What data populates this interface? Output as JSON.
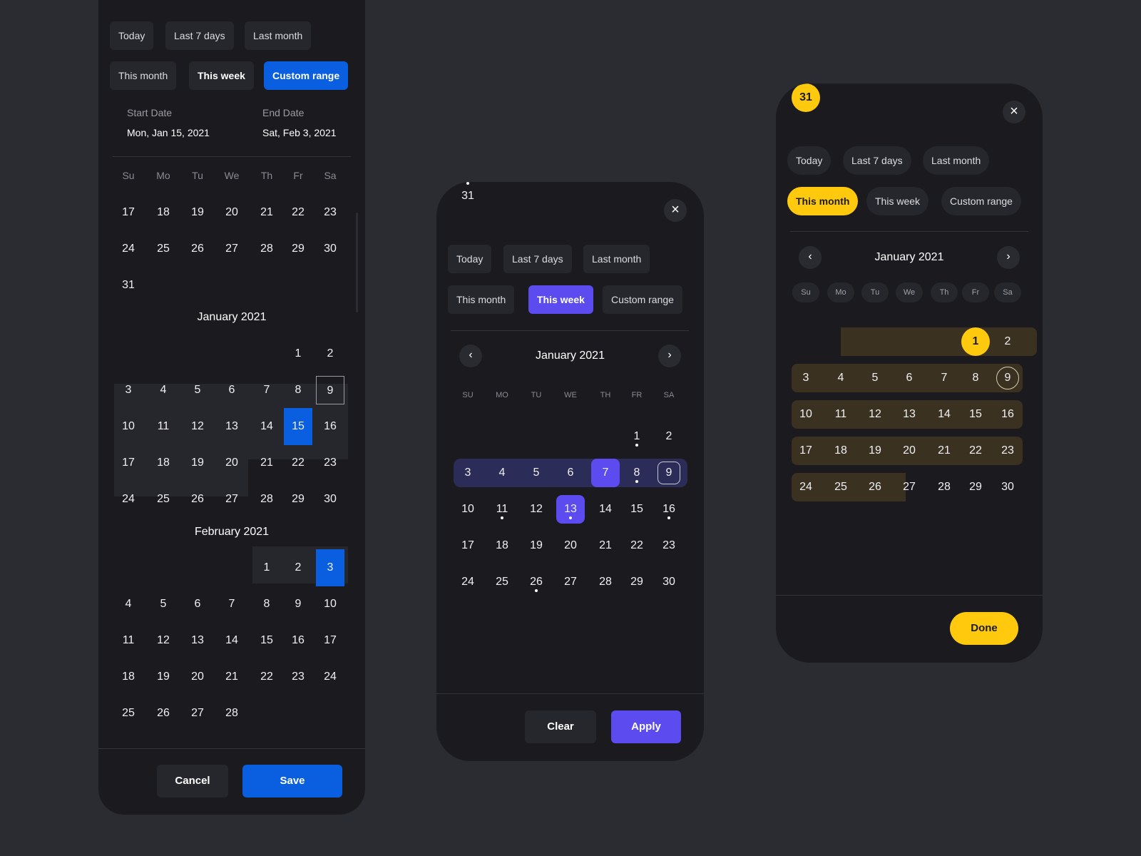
{
  "panel1": {
    "presets": [
      "Today",
      "Last 7 days",
      "Last month",
      "This month",
      "This week",
      "Custom range"
    ],
    "start_label": "Start Date",
    "start_value": "Mon, Jan 15, 2021",
    "end_label": "End Date",
    "end_value": "Sat, Feb 3, 2021",
    "weekdays": [
      "Su",
      "Mo",
      "Tu",
      "We",
      "Th",
      "Fr",
      "Sa"
    ],
    "prev_month_rows": [
      [
        "17",
        "18",
        "19",
        "20",
        "21",
        "22",
        "23"
      ],
      [
        "24",
        "25",
        "26",
        "27",
        "28",
        "29",
        "30"
      ],
      [
        "31"
      ]
    ],
    "jan_title": "January 2021",
    "feb_title": "February 2021",
    "cancel_label": "Cancel",
    "save_label": "Save"
  },
  "panel2": {
    "presets": [
      "Today",
      "Last 7 days",
      "Last month",
      "This month",
      "This week",
      "Custom range"
    ],
    "month_title": "January 2021",
    "weekdays": [
      "SU",
      "MO",
      "TU",
      "WE",
      "TH",
      "FR",
      "SA"
    ],
    "clear_label": "Clear",
    "apply_label": "Apply"
  },
  "panel3": {
    "presets": [
      "Today",
      "Last 7 days",
      "Last month",
      "This month",
      "This week",
      "Custom range"
    ],
    "month_title": "January 2021",
    "weekdays": [
      "Su",
      "Mo",
      "Tu",
      "We",
      "Th",
      "Fr",
      "Sa"
    ],
    "done_label": "Done"
  },
  "colors": {
    "background": "#2b2c31",
    "panel": "#1b1b1f",
    "blue_accent": "#0a5fe0",
    "violet_accent": "#5c4cf0",
    "yellow_accent": "#ffc90d"
  }
}
